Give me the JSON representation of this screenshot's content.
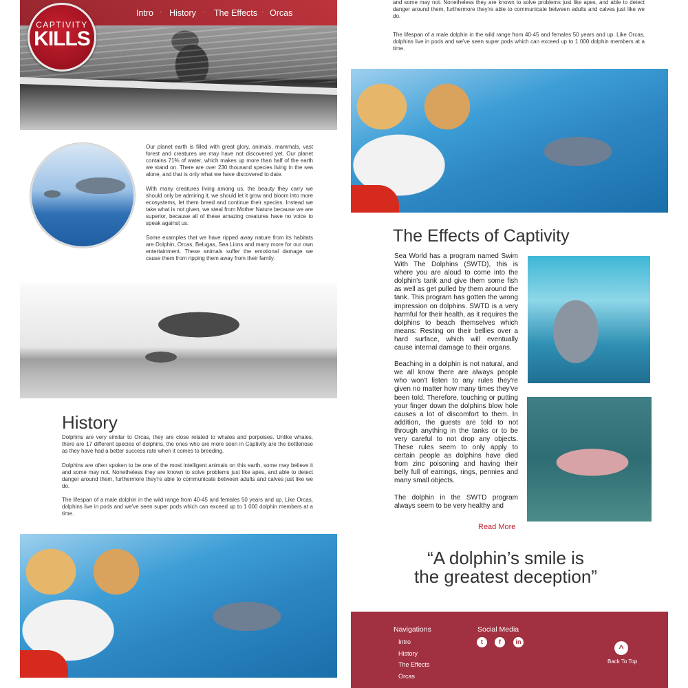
{
  "nav": {
    "items": [
      "Intro",
      "History",
      "The Effects",
      "Orcas"
    ],
    "separator": "·"
  },
  "logo": {
    "line1": "CAPTIVITY",
    "line2": "KILLS"
  },
  "intro": {
    "paragraphs": [
      "Our planet earth is filled with great glory, animals, mammals, vast forest and creatures we may have not discovered yet. Our planet contains 71% of water, which makes up more than half of the earth we stand on. There are over 230 thousand species living in the sea alone, and that is only what we have discovered to date.",
      "With many creatures living among us, the beauty they carry we should only be admiring it, we should let it grow and bloom into more ecosystems, let them breed and continue their species. Instead we take what is not given, we steal from Mother Nature because we are superior, because all of these amazing creatures have no voice to speak against us.",
      "Some examples that we have ripped away nature from its habitats are Dolphin, Orcas, Belugas, Sea Lions and many more for our own entertainment. These animals suffer the emotional damage we cause them from ripping them away from their family."
    ]
  },
  "history": {
    "title": "History",
    "paragraphs": [
      "Dolphins are very similar to Orcas, they are close related to whales and porpoises. Unlike whales, there are 17 different species of dolphins, the ones who are more seen in Captivity are the bottlenose as they have had a better success rate when it comes to breeding.",
      "Dolphins are often spoken to be one of the most intelligent animals on this earth, some may believe it and some may not. Nonetheless they are known to solve problems just like apes, and able to detect danger around them, furthermore they're able to communicate between adults and calves just like we do.",
      "The lifespan of a male dolphin in the wild range from 40-45 and females 50 years and up. Like Orcas, dolphins live in pods and we've seen super pods which can exceed up to 1 000 dolphin members at a time."
    ]
  },
  "right_top": {
    "paragraphs": [
      "Dolphins are often spoken to be one of the most intelligent animals on this earth, some may believe it and some may not. Nonetheless they are known to solve problems just like apes, and able to detect danger around them, furthermore they're able to communicate between adults and calves just like we do.",
      "The lifespan of a male dolphin in the wild range from 40-45 and females 50 years and up. Like Orcas, dolphins live in pods and we've seen super pods which can exceed up to 1 000 dolphin members at a time."
    ]
  },
  "effects": {
    "title": "The Effects of Captivity",
    "paragraphs": [
      "Sea World has a program named Swim With The Dolphins (SWTD), this is where you are aloud to come into the dolphin's tank and give them some fish as well as get pulled by them around the tank. This program has gotten the wrong impression on dolphins. SWTD is a very harmful for their health, as it requires the dolphins to beach themselves which means: Resting on their bellies over a hard surface, which will eventually cause internal damage to their organs.",
      "Beaching in a dolphin is not natural, and we all know there are always people who won't listen to any rules they're given no matter how many times they've been told. Therefore, touching or putting your finger down the dolphins blow hole causes a lot of discomfort to them. In addition, the guests are told to not through anything in the tanks or to be very careful to not drop any objects. These rules seem to only apply to certain people as dolphins have died from zinc poisoning and having their belly full of earrings, rings, pennies and many small objects.",
      "The dolphin in the SWTD program always seem to be very healthy and"
    ],
    "read_more": "Read More"
  },
  "quote": {
    "line1": "“A dolphin’s smile is",
    "line2": "the greatest deception”"
  },
  "footer": {
    "nav_heading": "Navigations",
    "nav_links": [
      "Intro",
      "History",
      "The Effects",
      "Orcas"
    ],
    "social_heading": "Social Media",
    "social_icons": [
      "twitter-icon",
      "facebook-icon",
      "linkedin-icon"
    ],
    "back_to_top": "Back To Top"
  },
  "colors": {
    "brand_red": "#a13040",
    "nav_red": "#b01c28",
    "link_red": "#c0202c"
  }
}
